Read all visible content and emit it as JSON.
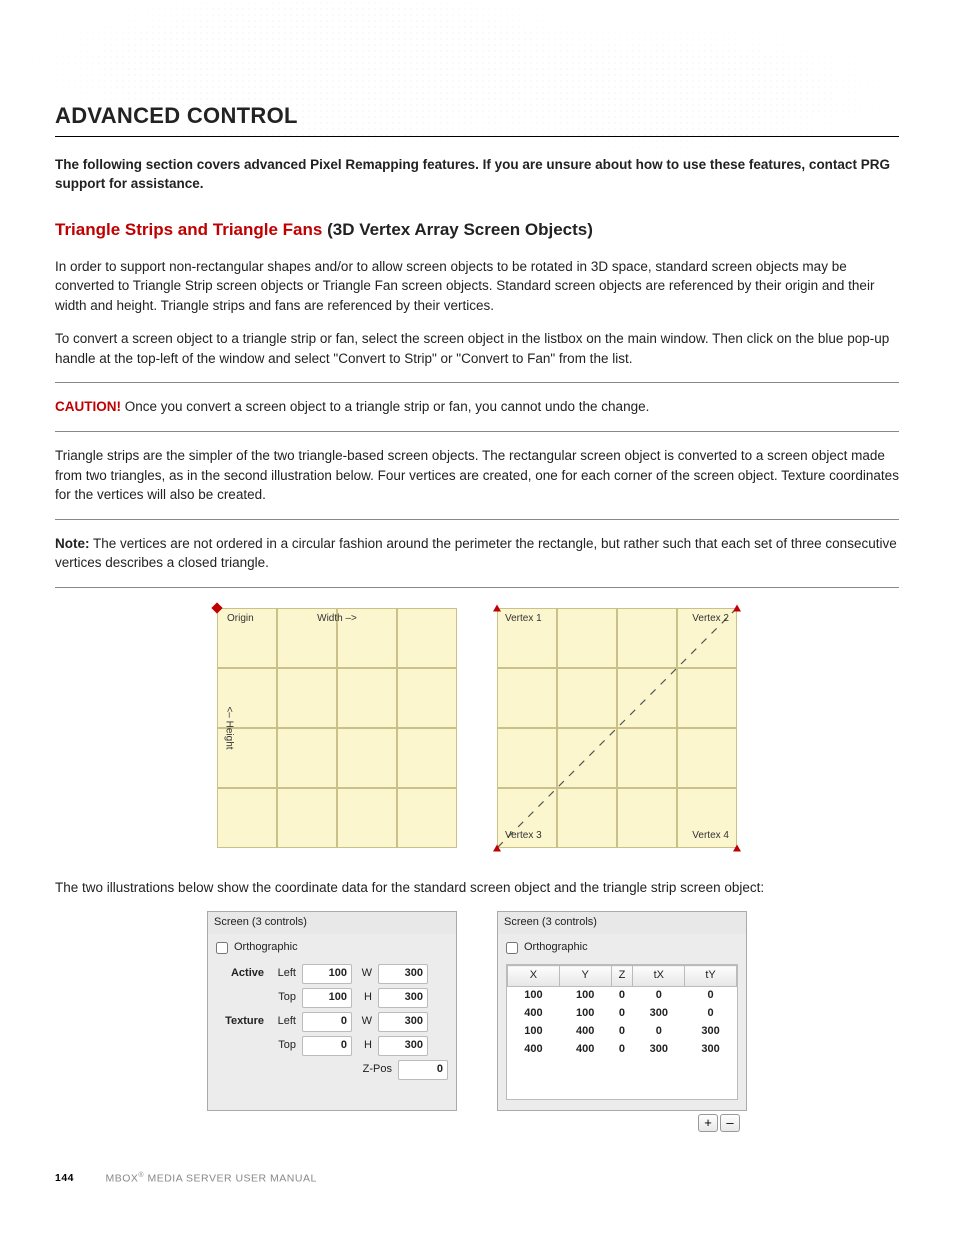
{
  "heading": "ADVANCED CONTROL",
  "intro": "The following section covers advanced Pixel Remapping features. If you are unsure about how to use these features, contact PRG support for assistance.",
  "sub_red": "Triangle Strips and Triangle Fans",
  "sub_rest": "(3D Vertex Array Screen Objects)",
  "p1": "In order to support non-rectangular shapes and/or to allow screen objects to be rotated in 3D space, standard screen objects may be converted to Triangle Strip screen objects or Triangle Fan screen objects. Standard screen objects are referenced by their origin and their width and height. Triangle strips and fans are referenced by their vertices.",
  "p2": "To convert a screen object to a triangle strip or fan, select the screen object in the listbox on the main window. Then click on the blue pop-up handle at the top-left of the window and select \"Convert to Strip\" or \"Convert to Fan\" from the list.",
  "caution_label": "CAUTION!",
  "caution_text": "Once you convert a screen object to a triangle strip or fan, you cannot undo the change.",
  "p3": "Triangle strips are the simpler of the two triangle-based screen objects. The rectangular screen object is converted to a screen object made from two triangles, as in the second illustration below. Four vertices are created, one for each corner of the screen object. Texture coordinates for the vertices will also be created.",
  "note_label": "Note:",
  "note_text": "The vertices are not ordered in a circular fashion around the perimeter the rectangle, but rather such that each set of three consecutive vertices describes a closed triangle.",
  "p4": "The two illustrations below show the coordinate data for the standard screen object and the triangle strip screen object:",
  "diagram1": {
    "origin": "Origin",
    "width": "Width –>",
    "height": "<– Height"
  },
  "diagram2": {
    "v1": "Vertex 1",
    "v2": "Vertex 2",
    "v3": "Vertex 3",
    "v4": "Vertex 4"
  },
  "panel_title": "Screen (3 controls)",
  "ortho_label": "Orthographic",
  "left_panel": {
    "row_labels": {
      "active": "Active",
      "texture": "Texture"
    },
    "sub_labels": {
      "left": "Left",
      "top": "Top",
      "w": "W",
      "h": "H",
      "zpos": "Z-Pos"
    },
    "active_left": "100",
    "active_w": "300",
    "active_top": "100",
    "active_h": "300",
    "texture_left": "0",
    "texture_w": "300",
    "texture_top": "0",
    "texture_h": "300",
    "zpos": "0"
  },
  "right_panel": {
    "headers": [
      "X",
      "Y",
      "Z",
      "tX",
      "tY"
    ],
    "rows": [
      [
        "100",
        "100",
        "0",
        "0",
        "0"
      ],
      [
        "400",
        "100",
        "0",
        "300",
        "0"
      ],
      [
        "100",
        "400",
        "0",
        "0",
        "300"
      ],
      [
        "400",
        "400",
        "0",
        "300",
        "300"
      ]
    ],
    "plus": "+",
    "minus": "–"
  },
  "footer": {
    "page": "144",
    "text_a": "MBOX",
    "text_b": " MEDIA SERVER USER MANUAL"
  }
}
